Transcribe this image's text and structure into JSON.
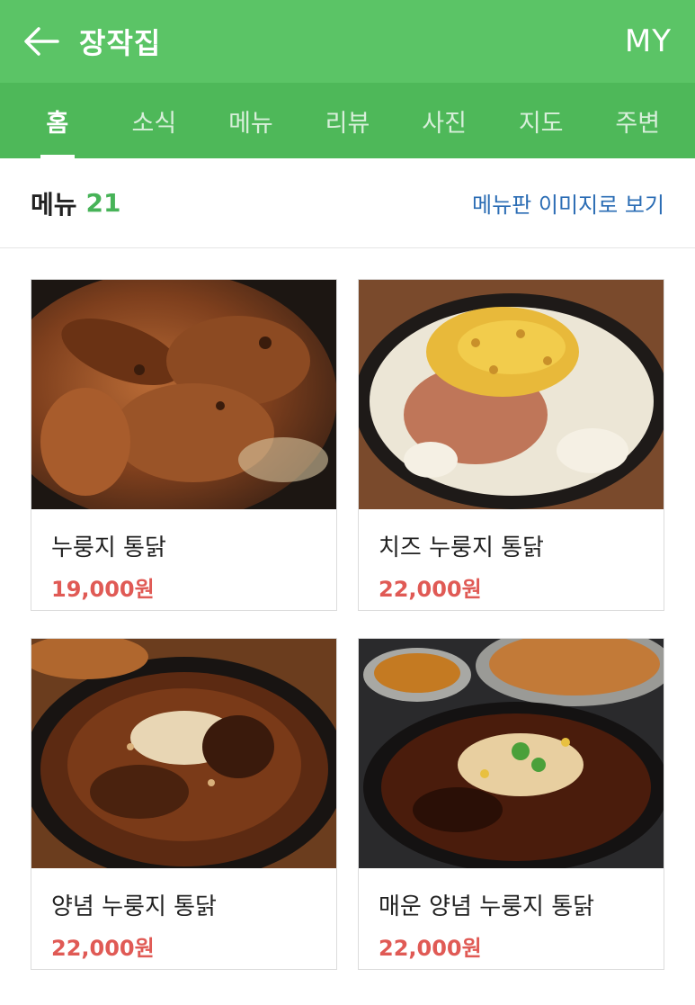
{
  "header": {
    "title": "장작집",
    "my_label": "MY"
  },
  "tabs": [
    {
      "label": "홈",
      "active": true
    },
    {
      "label": "소식"
    },
    {
      "label": "메뉴"
    },
    {
      "label": "리뷰"
    },
    {
      "label": "사진"
    },
    {
      "label": "지도"
    },
    {
      "label": "주변"
    }
  ],
  "section": {
    "title": "메뉴",
    "count": "21",
    "link": "메뉴판 이미지로 보기"
  },
  "menu_items": [
    {
      "name": "누룽지 통닭",
      "price": "19,000원"
    },
    {
      "name": "치즈 누룽지 통닭",
      "price": "22,000원"
    },
    {
      "name": "양념 누룽지 통닭",
      "price": "22,000원"
    },
    {
      "name": "매운 양념 누룽지 통닭",
      "price": "22,000원"
    }
  ],
  "colors": {
    "header_green": "#5bc466",
    "tab_green": "#4eb859",
    "count_green": "#47b358",
    "link_blue": "#2a6cb4",
    "price_red": "#e05a55"
  }
}
